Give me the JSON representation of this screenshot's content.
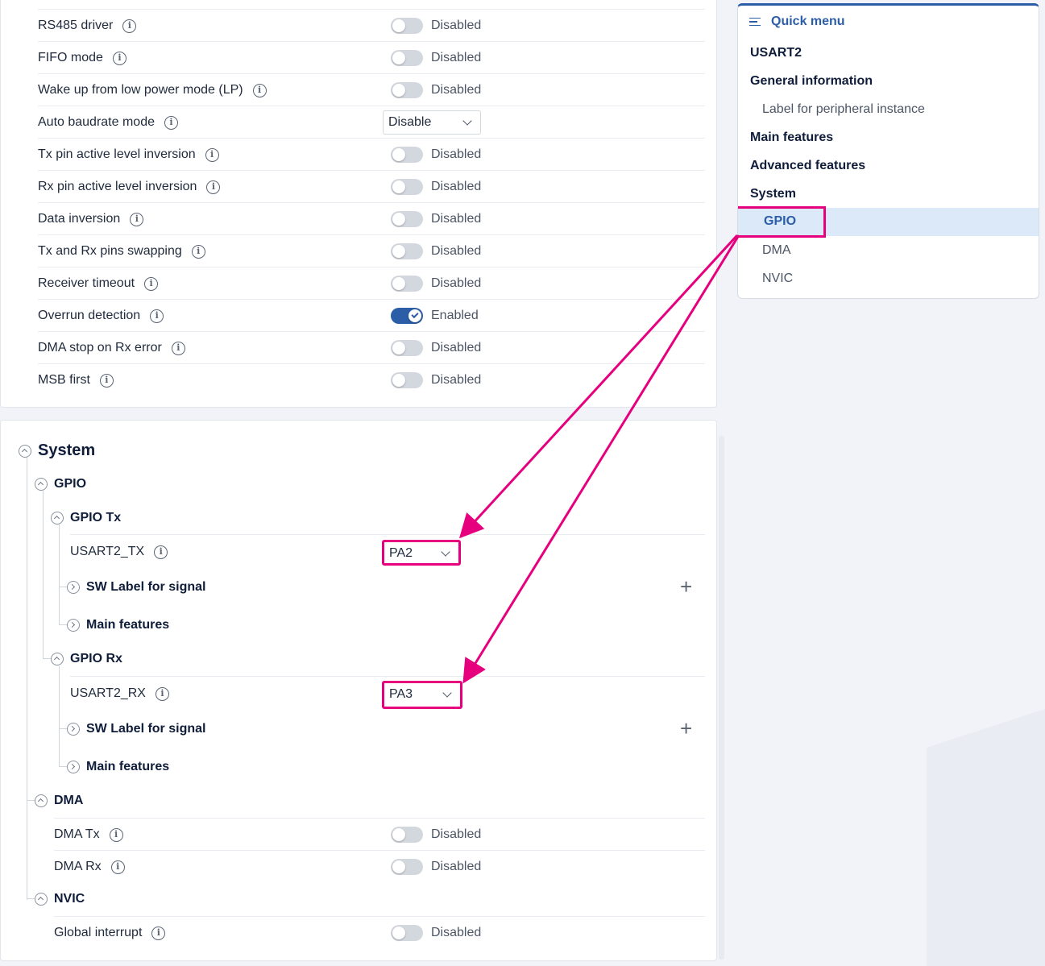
{
  "top_settings": [
    {
      "label": "RS485 driver",
      "control": "toggle",
      "on": false,
      "state": "Disabled"
    },
    {
      "label": "FIFO mode",
      "control": "toggle",
      "on": false,
      "state": "Disabled"
    },
    {
      "label": "Wake up from low power mode (LP)",
      "control": "toggle",
      "on": false,
      "state": "Disabled"
    },
    {
      "label": "Auto baudrate mode",
      "control": "select",
      "value": "Disable"
    },
    {
      "label": "Tx pin active level inversion",
      "control": "toggle",
      "on": false,
      "state": "Disabled"
    },
    {
      "label": "Rx pin active level inversion",
      "control": "toggle",
      "on": false,
      "state": "Disabled"
    },
    {
      "label": "Data inversion",
      "control": "toggle",
      "on": false,
      "state": "Disabled"
    },
    {
      "label": "Tx and Rx pins swapping",
      "control": "toggle",
      "on": false,
      "state": "Disabled"
    },
    {
      "label": "Receiver timeout",
      "control": "toggle",
      "on": false,
      "state": "Disabled"
    },
    {
      "label": "Overrun detection",
      "control": "toggle",
      "on": true,
      "state": "Enabled"
    },
    {
      "label": "DMA stop on Rx error",
      "control": "toggle",
      "on": false,
      "state": "Disabled"
    },
    {
      "label": "MSB first",
      "control": "toggle",
      "on": false,
      "state": "Disabled"
    }
  ],
  "system": {
    "title": "System",
    "gpio": {
      "title": "GPIO",
      "tx": {
        "title": "GPIO Tx",
        "signal_label": "USART2_TX",
        "pin": "PA2",
        "sw_label": "SW Label for signal",
        "main_features": "Main features"
      },
      "rx": {
        "title": "GPIO Rx",
        "signal_label": "USART2_RX",
        "pin": "PA3",
        "sw_label": "SW Label for signal",
        "main_features": "Main features"
      }
    },
    "dma": {
      "title": "DMA",
      "tx": {
        "label": "DMA Tx",
        "state": "Disabled"
      },
      "rx": {
        "label": "DMA Rx",
        "state": "Disabled"
      }
    },
    "nvic": {
      "title": "NVIC",
      "global": {
        "label": "Global interrupt",
        "state": "Disabled"
      }
    }
  },
  "quick_menu": {
    "title": "Quick menu",
    "peripheral": "USART2",
    "general_information": "General information",
    "label_for_peripheral": "Label for peripheral instance",
    "main_features": "Main features",
    "advanced_features": "Advanced features",
    "system": "System",
    "gpio": "GPIO",
    "dma": "DMA",
    "nvic": "NVIC"
  },
  "colors": {
    "accent": "#2c5ea8",
    "annotation": "#e6007e",
    "active_item_bg": "#dbe9f8"
  }
}
